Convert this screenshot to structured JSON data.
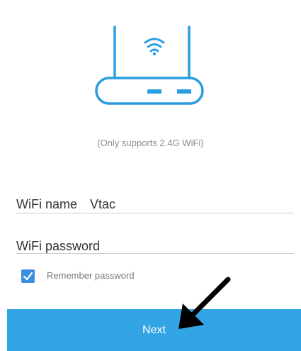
{
  "colors": {
    "accent": "#33a4e4",
    "router_stroke": "#2a9de0",
    "checkbox": "#3a8ee0",
    "hint_text": "#8c8c8c"
  },
  "illustration": {
    "icon": "router-icon",
    "wifi_icon": "wifi-icon"
  },
  "note": "(Only supports 2.4G WiFi)",
  "wifi_name": {
    "label": "WiFi name",
    "value": "Vtac"
  },
  "wifi_password": {
    "placeholder": "WiFi password",
    "value": ""
  },
  "remember": {
    "label": "Remember password",
    "checked": true
  },
  "next_button": {
    "label": "Next"
  },
  "annotation": {
    "icon": "pointer-arrow-icon"
  }
}
